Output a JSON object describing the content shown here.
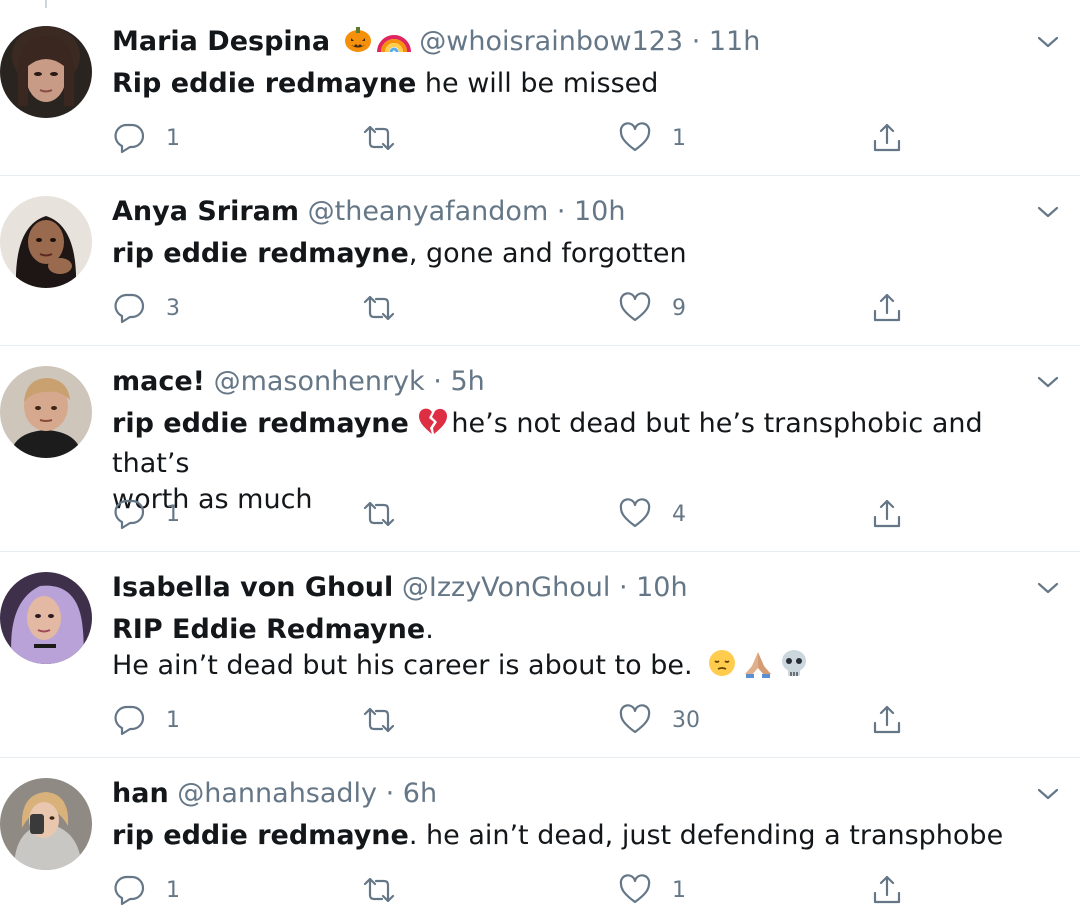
{
  "tweets": [
    {
      "name": "Maria Despina",
      "handle": "@whoisrainbow123",
      "time": "· 11h",
      "text_bold": "Rip eddie redmayne",
      "text_rest": " he will be missed",
      "text_line2": "",
      "name_emojis": [
        "jack-o-lantern-icon",
        "rainbow-icon"
      ],
      "body_emojis": [],
      "replies": "1",
      "retweets": "",
      "likes": "1"
    },
    {
      "name": "Anya Sriram",
      "handle": "@theanyafandom",
      "time": "· 10h",
      "text_bold": "rip eddie redmayne",
      "text_rest": ", gone and forgotten",
      "text_line2": "",
      "name_emojis": [],
      "body_emojis": [],
      "replies": "3",
      "retweets": "",
      "likes": "9"
    },
    {
      "name": "mace!",
      "handle": "@masonhenryk",
      "time": "· 5h",
      "text_bold": "rip eddie redmayne",
      "text_rest": " he’s not dead but he’s transphobic and that’s",
      "text_line2": "worth as much",
      "name_emojis": [],
      "body_emojis": [
        "broken-heart-icon"
      ],
      "replies": "1",
      "retweets": "",
      "likes": "4"
    },
    {
      "name": "Isabella von Ghoul",
      "handle": "@IzzyVonGhoul",
      "time": "· 10h",
      "text_bold": "RIP Eddie Redmayne",
      "text_rest": ".",
      "text_line2": "He ain’t dead but his career is about to be.",
      "name_emojis": [],
      "body_emojis": [
        "pensive-face-icon",
        "folded-hands-icon",
        "skull-icon"
      ],
      "replies": "1",
      "retweets": "",
      "likes": "30"
    },
    {
      "name": "han",
      "handle": "@hannahsadly",
      "time": "· 6h",
      "text_bold": "rip eddie redmayne",
      "text_rest": ". he ain’t dead, just defending a transphobe",
      "text_line2": "",
      "name_emojis": [],
      "body_emojis": [],
      "replies": "1",
      "retweets": "",
      "likes": "1"
    }
  ],
  "colors": {
    "text": "#14171a",
    "muted": "#657786",
    "divider": "#e6ecf0"
  }
}
